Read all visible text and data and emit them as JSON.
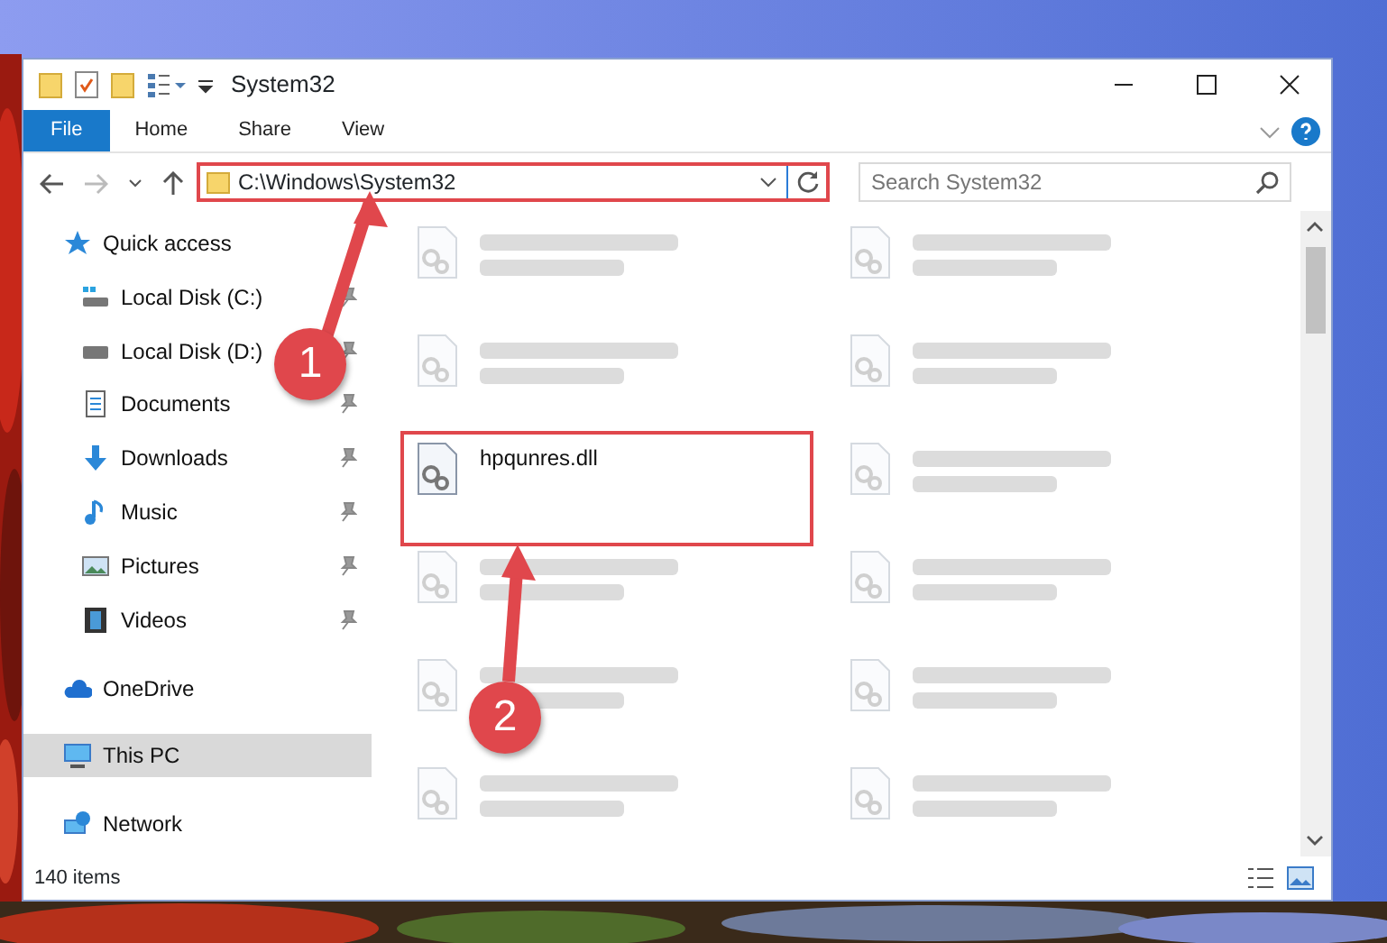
{
  "window": {
    "title": "System32"
  },
  "ribbon_tabs": [
    {
      "label": "File",
      "selected": true
    },
    {
      "label": "Home",
      "selected": false
    },
    {
      "label": "Share",
      "selected": false
    },
    {
      "label": "View",
      "selected": false
    }
  ],
  "address": {
    "path": "C:\\Windows\\System32",
    "highlighted": true
  },
  "search": {
    "placeholder": "Search System32"
  },
  "sidebar": {
    "items": [
      {
        "label": "Quick access",
        "kind": "quick",
        "pinned": false,
        "selected": false,
        "children": [
          {
            "label": "Local Disk (C:)",
            "kind": "drive-c",
            "pinned": true,
            "selected": false
          },
          {
            "label": "Local Disk (D:)",
            "kind": "drive",
            "pinned": true,
            "selected": false
          },
          {
            "label": "Documents",
            "kind": "documents",
            "pinned": true,
            "selected": false
          },
          {
            "label": "Downloads",
            "kind": "downloads",
            "pinned": true,
            "selected": false
          },
          {
            "label": "Music",
            "kind": "music",
            "pinned": true,
            "selected": false
          },
          {
            "label": "Pictures",
            "kind": "pictures",
            "pinned": true,
            "selected": false
          },
          {
            "label": "Videos",
            "kind": "videos",
            "pinned": true,
            "selected": false
          }
        ]
      },
      {
        "label": "OneDrive",
        "kind": "cloud",
        "pinned": false,
        "selected": false
      },
      {
        "label": "This PC",
        "kind": "pc",
        "pinned": false,
        "selected": true
      },
      {
        "label": "Network",
        "kind": "network",
        "pinned": false,
        "selected": false
      }
    ]
  },
  "files": [
    {
      "blurred": true,
      "highlighted": false
    },
    {
      "blurred": true,
      "highlighted": false
    },
    {
      "blurred": true,
      "highlighted": false
    },
    {
      "blurred": true,
      "highlighted": false
    },
    {
      "name": "hpqunres.dll",
      "blurred": false,
      "highlighted": true
    },
    {
      "blurred": true,
      "highlighted": false
    },
    {
      "blurred": true,
      "highlighted": false
    },
    {
      "blurred": true,
      "highlighted": false
    },
    {
      "blurred": true,
      "highlighted": false
    },
    {
      "blurred": true,
      "highlighted": false
    },
    {
      "blurred": true,
      "highlighted": false
    },
    {
      "blurred": true,
      "highlighted": false
    }
  ],
  "status_bar": {
    "item_count": "140 items"
  },
  "callouts": [
    {
      "number": "1"
    },
    {
      "number": "2"
    }
  ]
}
